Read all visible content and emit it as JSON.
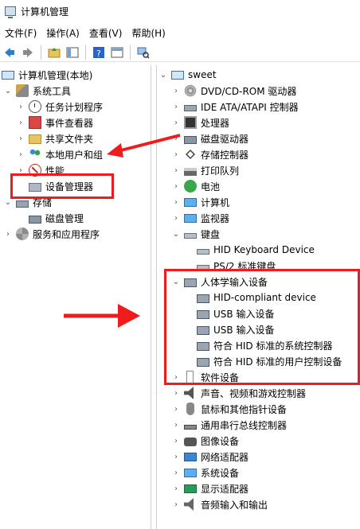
{
  "window": {
    "title": "计算机管理"
  },
  "menu": [
    "文件(F)",
    "操作(A)",
    "查看(V)",
    "帮助(H)"
  ],
  "left_tree": {
    "root": "计算机管理(本地)",
    "system_tools": "系统工具",
    "task_scheduler": "任务计划程序",
    "event_viewer": "事件查看器",
    "shared_folders": "共享文件夹",
    "local_users": "本地用户和组",
    "performance": "性能",
    "device_manager": "设备管理器",
    "storage": "存储",
    "disk_management": "磁盘管理",
    "services_apps": "服务和应用程序"
  },
  "right_tree": {
    "root": "sweet",
    "categories": [
      "DVD/CD-ROM 驱动器",
      "IDE ATA/ATAPI 控制器",
      "处理器",
      "磁盘驱动器",
      "存储控制器",
      "打印队列",
      "电池",
      "计算机",
      "监视器",
      "键盘"
    ],
    "keyboard_children": [
      "HID Keyboard Device",
      "PS/2 标准键盘"
    ],
    "hid_category": "人体学输入设备",
    "hid_children": [
      "HID-compliant device",
      "USB 输入设备",
      "USB 输入设备",
      "符合 HID 标准的系统控制器",
      "符合 HID 标准的用户控制设备"
    ],
    "more_categories": [
      "软件设备",
      "声音、视频和游戏控制器",
      "鼠标和其他指针设备",
      "通用串行总线控制器",
      "图像设备",
      "网络适配器",
      "系统设备",
      "显示适配器",
      "音频输入和输出"
    ]
  },
  "colors": {
    "highlight": "#ee1c1c"
  }
}
